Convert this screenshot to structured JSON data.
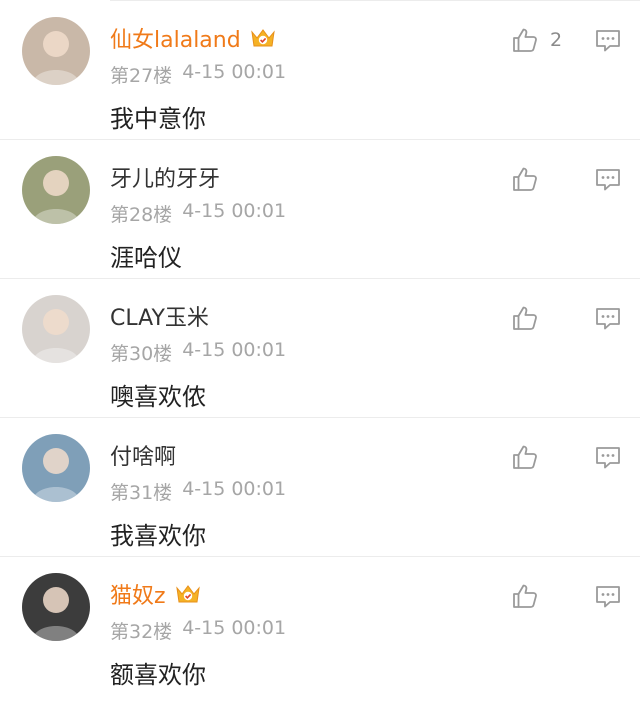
{
  "comments": [
    {
      "username": "仙女lalaland",
      "vip": true,
      "floor": "第27楼",
      "time": "4-15 00:01",
      "content": "我中意你",
      "likes": "2",
      "avatar_color": "#c9b8a8"
    },
    {
      "username": "牙儿的牙牙",
      "vip": false,
      "floor": "第28楼",
      "time": "4-15 00:01",
      "content": "涯哈仪",
      "likes": "",
      "avatar_color": "#9aa07a"
    },
    {
      "username": "CLAY玉米",
      "vip": false,
      "floor": "第30楼",
      "time": "4-15 00:01",
      "content": "噢喜欢侬",
      "likes": "",
      "avatar_color": "#d8d3cf"
    },
    {
      "username": "付啥啊",
      "vip": false,
      "floor": "第31楼",
      "time": "4-15 00:01",
      "content": "我喜欢你",
      "likes": "",
      "avatar_color": "#7f9fb8"
    },
    {
      "username": "猫奴z",
      "vip": true,
      "floor": "第32楼",
      "time": "4-15 00:01",
      "content": "额喜欢你",
      "likes": "",
      "avatar_color": "#3c3c3c"
    }
  ],
  "colors": {
    "vip_name": "#f07a19",
    "meta_text": "#a6a6a6",
    "icon_stroke": "#9a9a9a",
    "divider": "#ececec"
  },
  "icons": {
    "like": "thumbs-up-icon",
    "reply": "comment-icon",
    "vip": "crown-badge-icon"
  }
}
